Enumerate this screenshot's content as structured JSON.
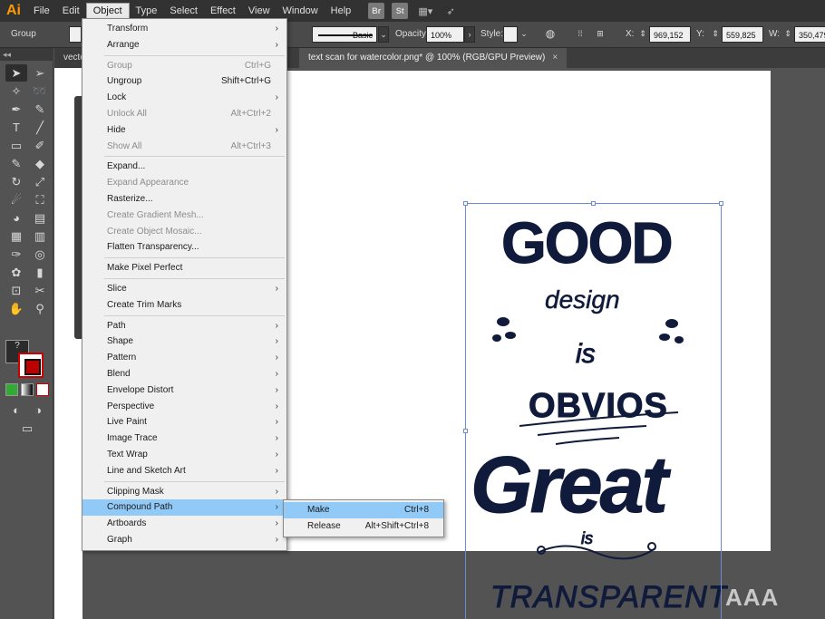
{
  "app": {
    "logo": "Ai"
  },
  "menubar": {
    "items": [
      "File",
      "Edit",
      "Object",
      "Type",
      "Select",
      "Effect",
      "View",
      "Window",
      "Help"
    ],
    "active": "Object",
    "bridge": "Br",
    "stock": "St"
  },
  "controlbar": {
    "selection_type": "Group",
    "stroke_style": "Basic",
    "opacity_label": "Opacity:",
    "opacity_value": "100%",
    "style_label": "Style:",
    "x_label": "X:",
    "x_value": "969,152 pt",
    "y_label": "Y:",
    "y_value": "559,825 pt",
    "w_label": "W:",
    "w_value": "350,479"
  },
  "tabs": [
    {
      "label": "vecto",
      "active": false
    },
    {
      "label": "text scan for watercolor.png* @ 100% (RGB/GPU Preview)",
      "active": true,
      "close": "×"
    }
  ],
  "toolbar": {
    "header": "◂◂",
    "fill_label": "?"
  },
  "object_menu": {
    "items": [
      {
        "label": "Transform",
        "submenu": true
      },
      {
        "label": "Arrange",
        "submenu": true
      },
      {
        "sep": true
      },
      {
        "label": "Group",
        "shortcut": "Ctrl+G",
        "disabled": true
      },
      {
        "label": "Ungroup",
        "shortcut": "Shift+Ctrl+G"
      },
      {
        "label": "Lock",
        "submenu": true
      },
      {
        "label": "Unlock All",
        "shortcut": "Alt+Ctrl+2",
        "disabled": true
      },
      {
        "label": "Hide",
        "submenu": true
      },
      {
        "label": "Show All",
        "shortcut": "Alt+Ctrl+3",
        "disabled": true
      },
      {
        "sep": true
      },
      {
        "label": "Expand..."
      },
      {
        "label": "Expand Appearance",
        "disabled": true
      },
      {
        "label": "Rasterize..."
      },
      {
        "label": "Create Gradient Mesh...",
        "disabled": true
      },
      {
        "label": "Create Object Mosaic...",
        "disabled": true
      },
      {
        "label": "Flatten Transparency..."
      },
      {
        "sep": true
      },
      {
        "label": "Make Pixel Perfect"
      },
      {
        "sep": true
      },
      {
        "label": "Slice",
        "submenu": true
      },
      {
        "label": "Create Trim Marks"
      },
      {
        "sep": true
      },
      {
        "label": "Path",
        "submenu": true
      },
      {
        "label": "Shape",
        "submenu": true
      },
      {
        "label": "Pattern",
        "submenu": true
      },
      {
        "label": "Blend",
        "submenu": true
      },
      {
        "label": "Envelope Distort",
        "submenu": true
      },
      {
        "label": "Perspective",
        "submenu": true
      },
      {
        "label": "Live Paint",
        "submenu": true
      },
      {
        "label": "Image Trace",
        "submenu": true
      },
      {
        "label": "Text Wrap",
        "submenu": true
      },
      {
        "label": "Line and Sketch Art",
        "submenu": true
      },
      {
        "sep": true
      },
      {
        "label": "Clipping Mask",
        "submenu": true
      },
      {
        "label": "Compound Path",
        "submenu": true,
        "highlighted": true
      },
      {
        "label": "Artboards",
        "submenu": true
      },
      {
        "label": "Graph",
        "submenu": true
      }
    ],
    "submenu_arrow": "›"
  },
  "compound_path_submenu": {
    "items": [
      {
        "label": "Make",
        "shortcut": "Ctrl+8",
        "highlighted": true
      },
      {
        "label": "Release",
        "shortcut": "Alt+Shift+Ctrl+8"
      }
    ]
  },
  "artwork": {
    "line1": "GOOD",
    "line2": "design",
    "line3": "is",
    "line4": "OBVIOS",
    "line5": "Great",
    "line6": "is",
    "line7": "TRANSPARENT",
    "ink_color": "#101a3a",
    "selection_color": "#6d8bd6"
  },
  "watermark": "AAA",
  "colors": {
    "menu_bg": "#f0f0f0",
    "menu_highlight": "#91c9f7",
    "menubar_bg": "#323232",
    "workspace_bg": "#535353",
    "logo": "#ff9a00"
  }
}
